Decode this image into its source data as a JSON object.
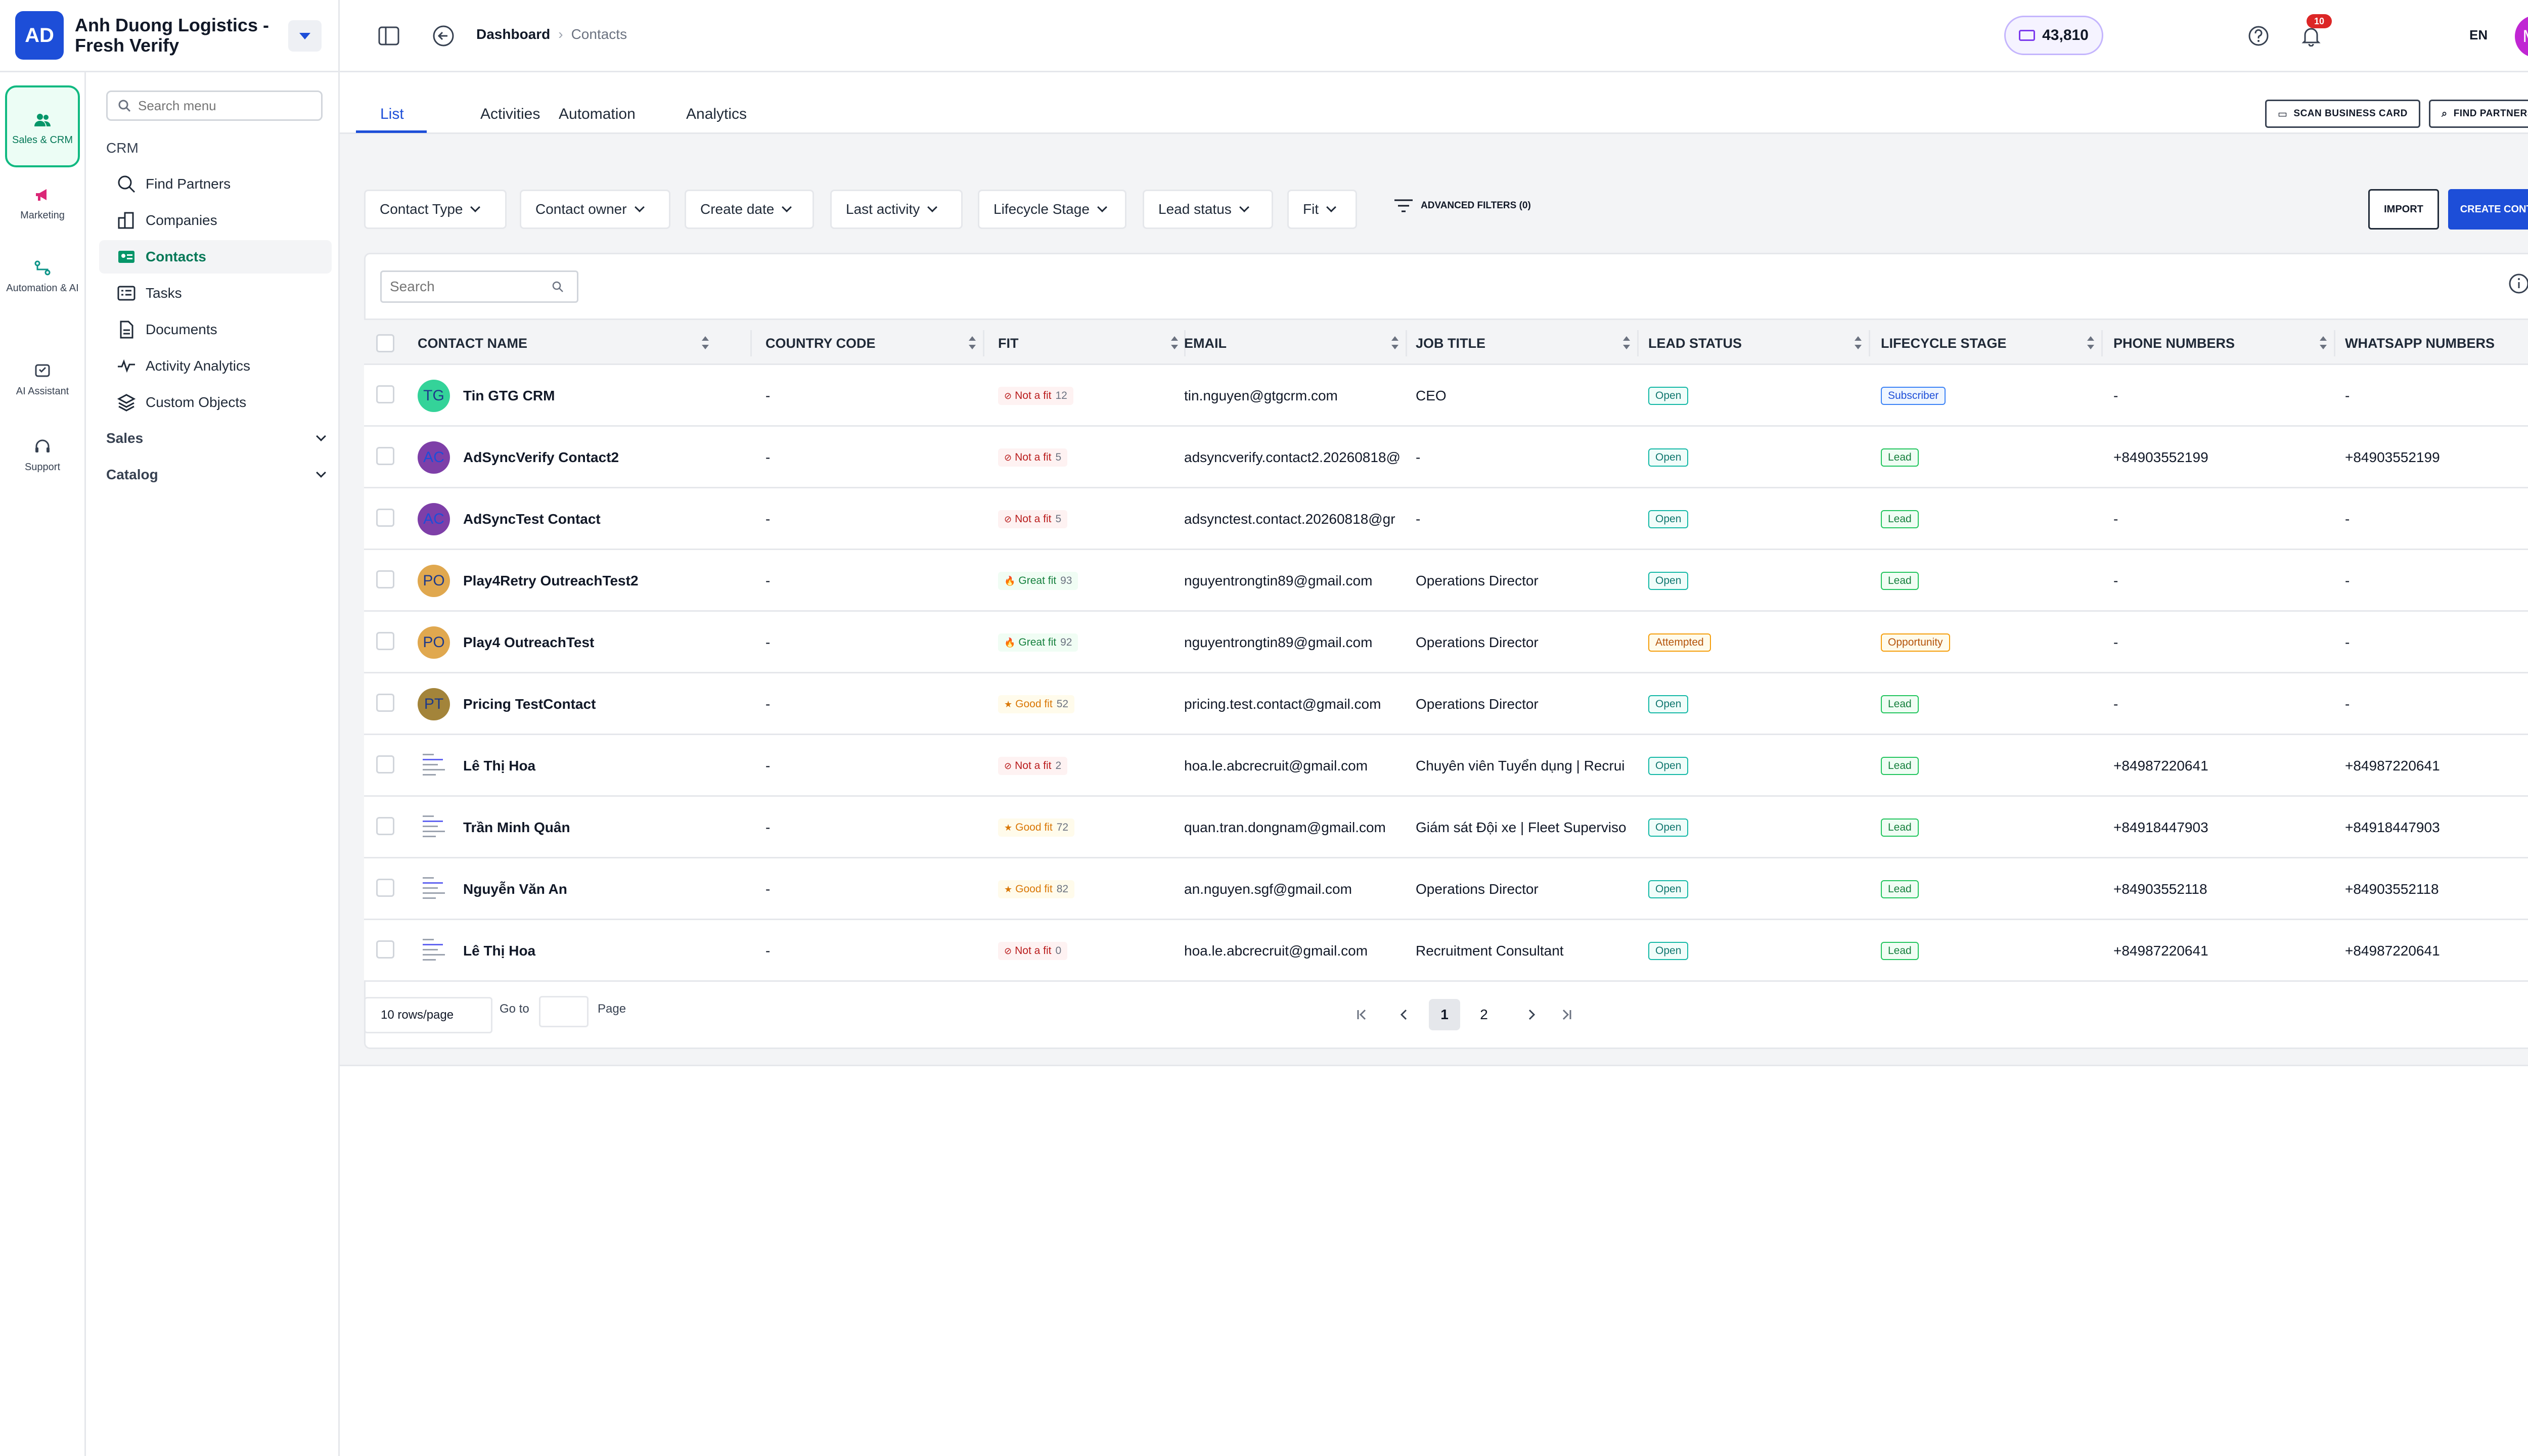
{
  "company": {
    "initials": "AD",
    "name": "Anh Duong Logistics - Fresh Verify"
  },
  "rail": [
    {
      "label": "Sales & CRM",
      "icon": "users-icon",
      "active": true
    },
    {
      "label": "Marketing",
      "icon": "megaphone-icon"
    },
    {
      "label": "Automation & AI",
      "icon": "automation-icon"
    },
    {
      "label": "AI Assistant",
      "icon": "ai-assistant-icon"
    },
    {
      "label": "Support",
      "icon": "headset-icon"
    }
  ],
  "menu": {
    "search_placeholder": "Search menu",
    "section": "CRM",
    "items": [
      {
        "label": "Find Partners",
        "icon": "search-icon"
      },
      {
        "label": "Companies",
        "icon": "building-icon"
      },
      {
        "label": "Contacts",
        "icon": "contact-card-icon",
        "active": true
      },
      {
        "label": "Tasks",
        "icon": "tasks-icon"
      },
      {
        "label": "Documents",
        "icon": "document-icon"
      },
      {
        "label": "Activity Analytics",
        "icon": "pulse-icon"
      },
      {
        "label": "Custom Objects",
        "icon": "layers-icon"
      }
    ],
    "groups": [
      "Sales",
      "Catalog"
    ]
  },
  "header": {
    "breadcrumb": [
      "Dashboard",
      "Contacts"
    ],
    "notifications": "10",
    "credits": "43,810",
    "language": "EN",
    "user_initials": "MR"
  },
  "tabs": [
    "List",
    "Activities",
    "Automation",
    "Analytics"
  ],
  "actions": {
    "scan": "SCAN BUSINESS CARD",
    "find": "FIND PARTNERS",
    "import": "IMPORT",
    "create": "CREATE CONTACT"
  },
  "filters": [
    "Contact Type",
    "Contact owner",
    "Create date",
    "Last activity",
    "Lifecycle Stage",
    "Lead status",
    "Fit"
  ],
  "advanced_filters": "ADVANCED FILTERS (0)",
  "table": {
    "search_placeholder": "Search",
    "columns": [
      "CONTACT NAME",
      "COUNTRY CODE",
      "FIT",
      "EMAIL",
      "JOB TITLE",
      "LEAD STATUS",
      "LIFECYCLE STAGE",
      "PHONE NUMBERS",
      "WHATSAPP NUMBERS"
    ],
    "rows": [
      {
        "initials": "TG",
        "avatar": "#34d399",
        "name": "Tin GTG CRM",
        "country": "-",
        "fit_label": "Not a fit",
        "fit_score": "12",
        "fit_kind": "bad",
        "email": "tin.nguyen@gtgcrm.com",
        "job": "CEO",
        "lead": "Open",
        "lifecycle": "Subscriber",
        "phone": "-",
        "whatsapp": "-"
      },
      {
        "initials": "AC",
        "avatar": "#7e3fa8",
        "name": "AdSyncVerify Contact2",
        "country": "-",
        "fit_label": "Not a fit",
        "fit_score": "5",
        "fit_kind": "bad",
        "email": "adsyncverify.contact2.20260818@",
        "job": "-",
        "lead": "Open",
        "lifecycle": "Lead",
        "phone": "+84903552199",
        "whatsapp": "+84903552199"
      },
      {
        "initials": "AC",
        "avatar": "#7e3fa8",
        "name": "AdSyncTest Contact",
        "country": "-",
        "fit_label": "Not a fit",
        "fit_score": "5",
        "fit_kind": "bad",
        "email": "adsynctest.contact.20260818@gr",
        "job": "-",
        "lead": "Open",
        "lifecycle": "Lead",
        "phone": "-",
        "whatsapp": "-"
      },
      {
        "initials": "PO",
        "avatar": "#e0a84f",
        "name": "Play4Retry OutreachTest2",
        "country": "-",
        "fit_label": "Great fit",
        "fit_score": "93",
        "fit_kind": "great",
        "email": "nguyentrongtin89@gmail.com",
        "job": "Operations Director",
        "lead": "Open",
        "lifecycle": "Lead",
        "phone": "-",
        "whatsapp": "-"
      },
      {
        "initials": "PO",
        "avatar": "#e0a84f",
        "name": "Play4 OutreachTest",
        "country": "-",
        "fit_label": "Great fit",
        "fit_score": "92",
        "fit_kind": "great",
        "email": "nguyentrongtin89@gmail.com",
        "job": "Operations Director",
        "lead": "Attempted",
        "lifecycle": "Opportunity",
        "phone": "-",
        "whatsapp": "-"
      },
      {
        "initials": "PT",
        "avatar": "#a3843a",
        "name": "Pricing TestContact",
        "country": "-",
        "fit_label": "Good fit",
        "fit_score": "52",
        "fit_kind": "good",
        "email": "pricing.test.contact@gmail.com",
        "job": "Operations Director",
        "lead": "Open",
        "lifecycle": "Lead",
        "phone": "-",
        "whatsapp": "-"
      },
      {
        "initials": "",
        "avatar": "image",
        "name": "Lê Thị Hoa",
        "country": "-",
        "fit_label": "Not a fit",
        "fit_score": "2",
        "fit_kind": "bad",
        "email": "hoa.le.abcrecruit@gmail.com",
        "job": "Chuyên viên Tuyển dụng | Recrui",
        "lead": "Open",
        "lifecycle": "Lead",
        "phone": "+84987220641",
        "whatsapp": "+84987220641"
      },
      {
        "initials": "",
        "avatar": "image",
        "name": "Trần Minh Quân",
        "country": "-",
        "fit_label": "Good fit",
        "fit_score": "72",
        "fit_kind": "good",
        "email": "quan.tran.dongnam@gmail.com",
        "job": "Giám sát Đội xe | Fleet Superviso",
        "lead": "Open",
        "lifecycle": "Lead",
        "phone": "+84918447903",
        "whatsapp": "+84918447903"
      },
      {
        "initials": "",
        "avatar": "image",
        "name": "Nguyễn Văn An",
        "country": "-",
        "fit_label": "Good fit",
        "fit_score": "82",
        "fit_kind": "good",
        "email": "an.nguyen.sgf@gmail.com",
        "job": "Operations Director",
        "lead": "Open",
        "lifecycle": "Lead",
        "phone": "+84903552118",
        "whatsapp": "+84903552118"
      },
      {
        "initials": "",
        "avatar": "image",
        "name": "Lê Thị Hoa",
        "country": "-",
        "fit_label": "Not a fit",
        "fit_score": "0",
        "fit_kind": "bad",
        "email": "hoa.le.abcrecruit@gmail.com",
        "job": "Recruitment Consultant",
        "lead": "Open",
        "lifecycle": "Lead",
        "phone": "+84987220641",
        "whatsapp": "+84987220641"
      }
    ]
  },
  "pagination": {
    "rows_per_page": "10 rows/page",
    "goto_label": "Go to",
    "page_label": "Page",
    "pages": [
      "1",
      "2"
    ],
    "current": "1"
  }
}
